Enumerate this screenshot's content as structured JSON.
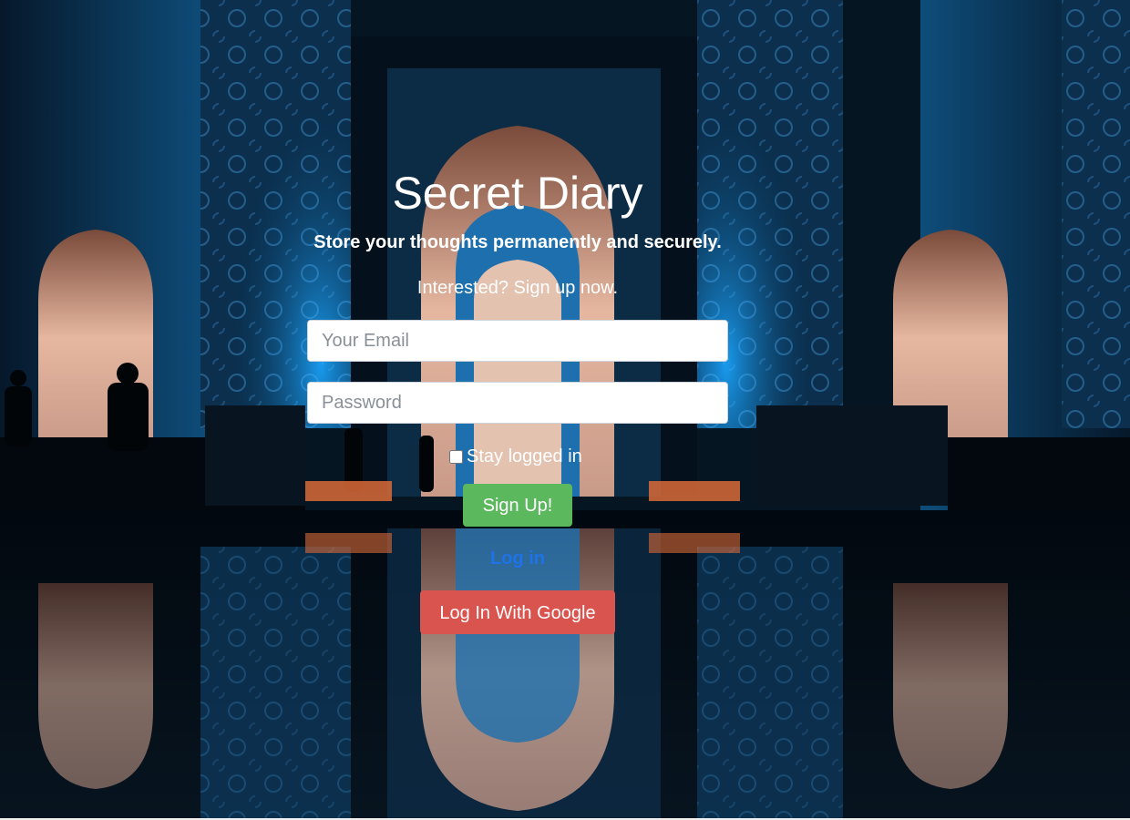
{
  "header": {
    "title": "Secret Diary",
    "tagline": "Store your thoughts permanently and securely.",
    "cta": "Interested? Sign up now."
  },
  "form": {
    "email_placeholder": "Your Email",
    "password_placeholder": "Password",
    "stay_logged_in_label": "Stay logged in",
    "stay_logged_in_checked": false,
    "signup_label": "Sign Up!",
    "login_link": "Log in",
    "google_label": "Log In With Google"
  },
  "colors": {
    "signup_button": "#5cb85c",
    "google_button": "#d9534f",
    "login_link": "#1e73e8"
  }
}
